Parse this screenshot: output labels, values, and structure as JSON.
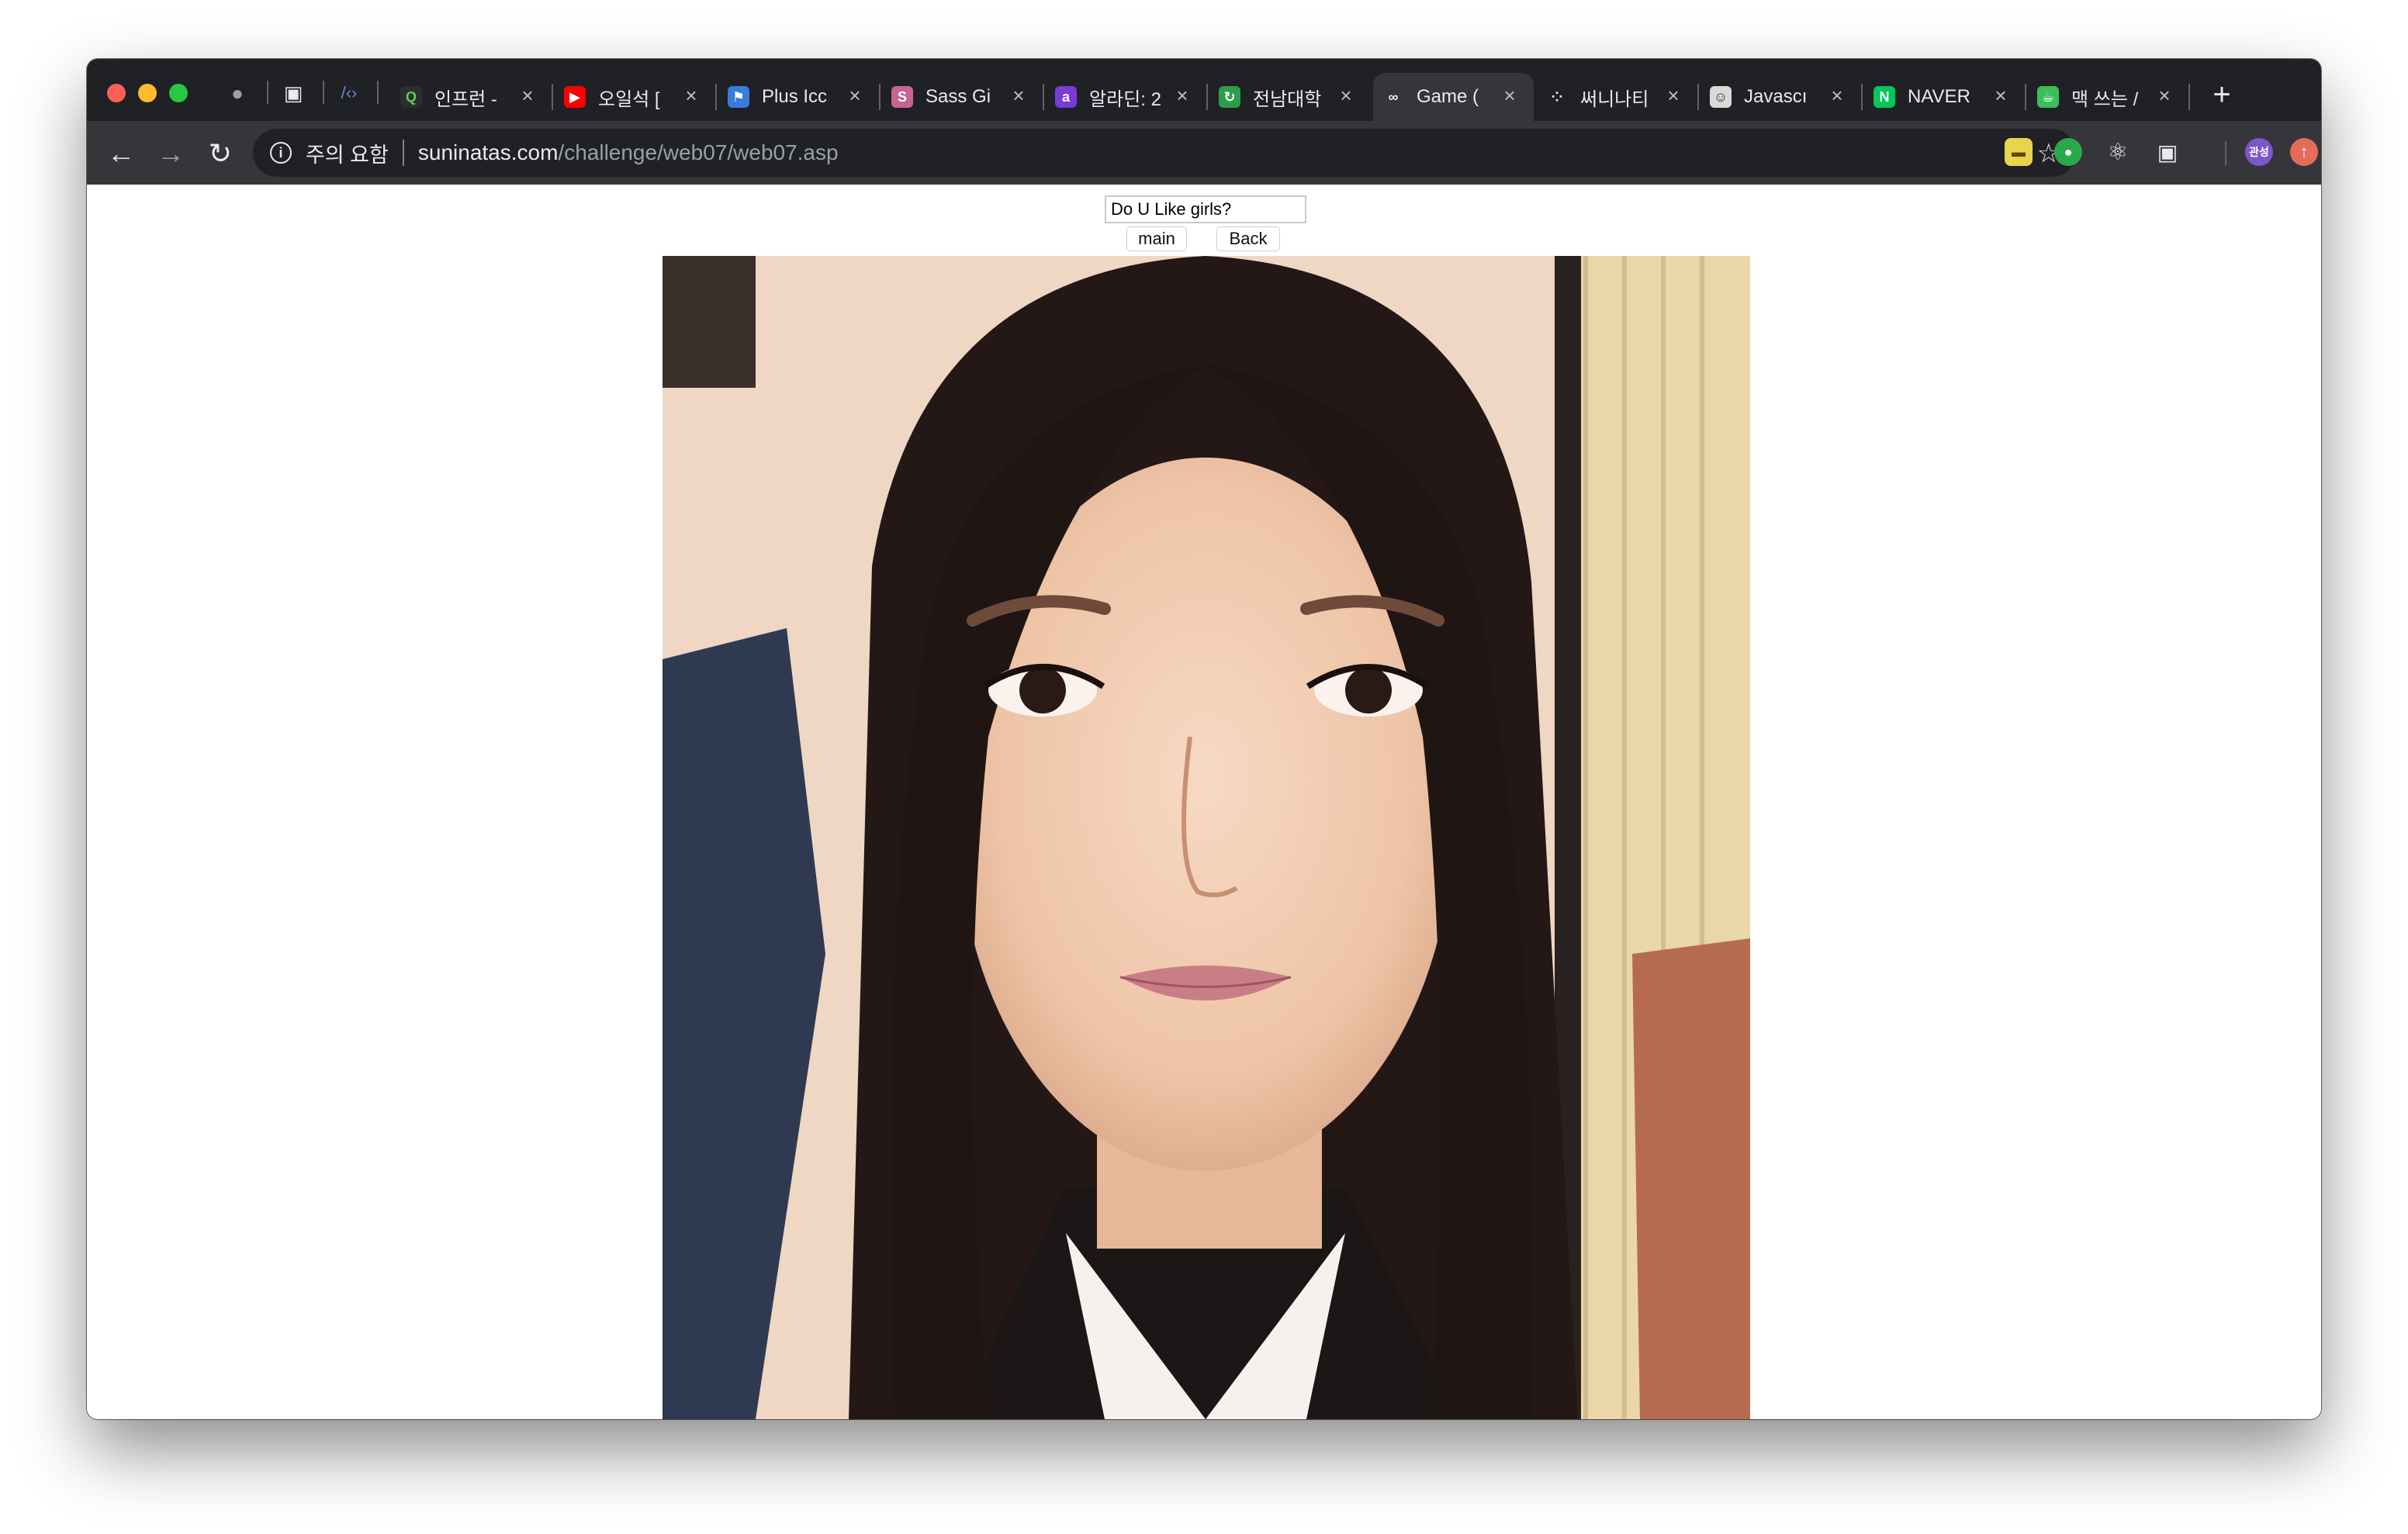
{
  "browser": {
    "tabs": [
      {
        "title": "인프런 -",
        "favicon_color": "#2d2d2d",
        "favicon_text": "Q",
        "favicon_fg": "#57d15b",
        "active": false
      },
      {
        "title": "오일석 [",
        "favicon_color": "#ff0000",
        "favicon_text": "▶",
        "favicon_fg": "#ffffff",
        "active": false
      },
      {
        "title": "Plus Icc",
        "favicon_color": "#3b7bdc",
        "favicon_text": "⚑",
        "favicon_fg": "#ffffff",
        "active": false
      },
      {
        "title": "Sass Gi",
        "favicon_color": "#c76494",
        "favicon_text": "S",
        "favicon_fg": "#ffffff",
        "active": false
      },
      {
        "title": "알라딘: 2",
        "favicon_color": "#7a3ad8",
        "favicon_text": "a",
        "favicon_fg": "#ffffff",
        "active": false
      },
      {
        "title": "전남대학",
        "favicon_color": "#2d9d4a",
        "favicon_text": "↻",
        "favicon_fg": "#ffffff",
        "active": false
      },
      {
        "title": "Game (",
        "favicon_color": "#35363a",
        "favicon_text": "∞",
        "favicon_fg": "#e8eaed",
        "active": true
      },
      {
        "title": "써니나티",
        "favicon_color": "#202124",
        "favicon_text": "⁘",
        "favicon_fg": "#e8eaed",
        "active": false
      },
      {
        "title": "Javascı",
        "favicon_color": "#d9d9d9",
        "favicon_text": "☺",
        "favicon_fg": "#333333",
        "active": false
      },
      {
        "title": "NAVER",
        "favicon_color": "#03c75a",
        "favicon_text": "N",
        "favicon_fg": "#ffffff",
        "active": false
      },
      {
        "title": "맥 쓰는 /",
        "favicon_color": "#3dbe5a",
        "favicon_text": "☕",
        "favicon_fg": "#ffffff",
        "active": false
      }
    ],
    "security_warning": "주의 요함",
    "url_host": "suninatas.com",
    "url_path": "/challenge/web07/web07.asp",
    "profile_initials": "관성"
  },
  "page": {
    "answer_value": "Do U Like girls?",
    "main_button": "main",
    "back_button": "Back",
    "photo_alt": "portrait photo"
  }
}
